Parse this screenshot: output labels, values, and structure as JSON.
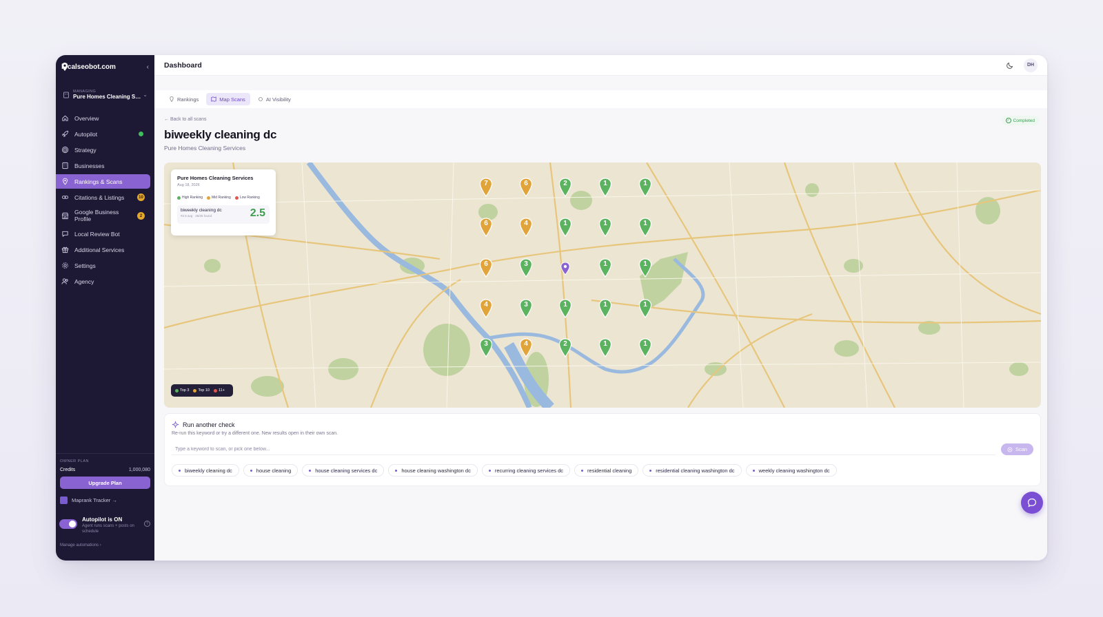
{
  "sidebar": {
    "brand": "localseobot.com",
    "managing_label": "MANAGING",
    "business": "Pure Homes Cleaning Serv...",
    "items": [
      {
        "label": "Overview",
        "icon": "home-icon"
      },
      {
        "label": "Autopilot",
        "icon": "rocket-icon",
        "status": "active"
      },
      {
        "label": "Strategy",
        "icon": "target-icon"
      },
      {
        "label": "Businesses",
        "icon": "building-icon"
      },
      {
        "label": "Rankings & Scans",
        "icon": "map-pin-icon",
        "active": true
      },
      {
        "label": "Citations & Listings",
        "icon": "link-icon",
        "badge": "10"
      },
      {
        "label": "Google Business Profile",
        "icon": "store-icon",
        "badge": "2"
      },
      {
        "label": "Local Review Bot",
        "icon": "chat-icon"
      },
      {
        "label": "Additional Services",
        "icon": "gift-icon"
      },
      {
        "label": "Settings",
        "icon": "gear-icon"
      },
      {
        "label": "Agency",
        "icon": "users-icon"
      }
    ],
    "plan_label": "OWNER PLAN",
    "credits_label": "Credits",
    "credits_value": "1,000,080",
    "upgrade_label": "Upgrade Plan",
    "maprank_label": "Maprank Tracker →",
    "autopilot_title": "Autopilot is ON",
    "autopilot_sub": "Agent runs scans + posts on schedule",
    "autopilot_help": "?",
    "manage_label": "Manage automations ›"
  },
  "topbar": {
    "title": "Dashboard",
    "avatar": "DH"
  },
  "tabs": [
    {
      "label": "Rankings",
      "icon": "pin-icon"
    },
    {
      "label": "Map Scans",
      "icon": "map-icon",
      "active": true
    },
    {
      "label": "AI Visibility",
      "icon": "sparkle-icon"
    }
  ],
  "scan": {
    "back": "← Back to all scans",
    "status": "Completed",
    "keyword": "biweekly cleaning dc",
    "business": "Pure Homes Cleaning Services"
  },
  "map_card": {
    "business": "Pure Homes Cleaning Services",
    "date": "Aug 18, 2026",
    "legend": [
      "High Ranking",
      "Mid Ranking",
      "Low Ranking"
    ],
    "keyword": "biweekly cleaning dc",
    "meta": "#2.5 avg · 25/25 found",
    "score": "2.5"
  },
  "map_legend": [
    "Top 3",
    "Top 10",
    "11+"
  ],
  "colors": {
    "green": "#5bb35f",
    "orange": "#e0a43a",
    "red": "#e0574f",
    "accent": "#8a63d2"
  },
  "grid_ranks": [
    [
      "7",
      "6",
      "2",
      "1",
      "1"
    ],
    [
      "6",
      "4",
      "1",
      "1",
      "1"
    ],
    [
      "6",
      "3",
      "",
      "1",
      "1"
    ],
    [
      "4",
      "3",
      "1",
      "1",
      "1"
    ],
    [
      "3",
      "4",
      "2",
      "1",
      "1"
    ]
  ],
  "run": {
    "title": "Run another check",
    "desc": "Re-run this keyword or try a different one. New results open in their own scan.",
    "placeholder": "Type a keyword to scan, or pick one below...",
    "scan_label": "Scan",
    "chips": [
      "biweekly cleaning dc",
      "house cleaning",
      "house cleaning services dc",
      "house cleaning washington dc",
      "recurring cleaning services dc",
      "residential cleaning",
      "residential cleaning washington dc",
      "weekly cleaning washington dc"
    ]
  }
}
